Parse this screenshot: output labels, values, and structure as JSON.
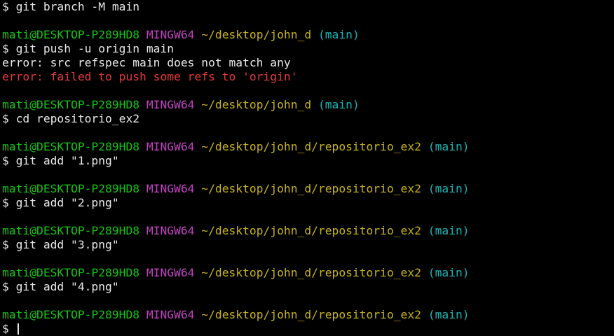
{
  "colors": {
    "background": "#000000",
    "text": "#e8e8e8",
    "user_host": "#13c313",
    "system": "#c042c0",
    "path": "#c6b31a",
    "branch": "#19b2b2",
    "error": "#e5383b"
  },
  "prompt": {
    "user_host": "mati@DESKTOP-P289HD8",
    "system": "MINGW64",
    "symbol": "$"
  },
  "lines": {
    "l1_cmd": "$ git branch -M main",
    "p1": {
      "path": "~/desktop/john_d",
      "branch": "(main)"
    },
    "l2_cmd": "$ git push -u origin main",
    "l2_err1": "error: src refspec main does not match any",
    "l2_err2": "error: failed to push some refs to 'origin'",
    "p2": {
      "path": "~/desktop/john_d",
      "branch": "(main)"
    },
    "l3_cmd": "$ cd repositorio_ex2",
    "p3": {
      "path": "~/desktop/john_d/repositorio_ex2",
      "branch": "(main)"
    },
    "l4_cmd": "$ git add \"1.png\"",
    "p4": {
      "path": "~/desktop/john_d/repositorio_ex2",
      "branch": "(main)"
    },
    "l5_cmd": "$ git add \"2.png\"",
    "p5": {
      "path": "~/desktop/john_d/repositorio_ex2",
      "branch": "(main)"
    },
    "l6_cmd": "$ git add \"3.png\"",
    "p6": {
      "path": "~/desktop/john_d/repositorio_ex2",
      "branch": "(main)"
    },
    "l7_cmd": "$ git add \"4.png\"",
    "p7": {
      "path": "~/desktop/john_d/repositorio_ex2",
      "branch": "(main)"
    },
    "current_input": "$ "
  }
}
